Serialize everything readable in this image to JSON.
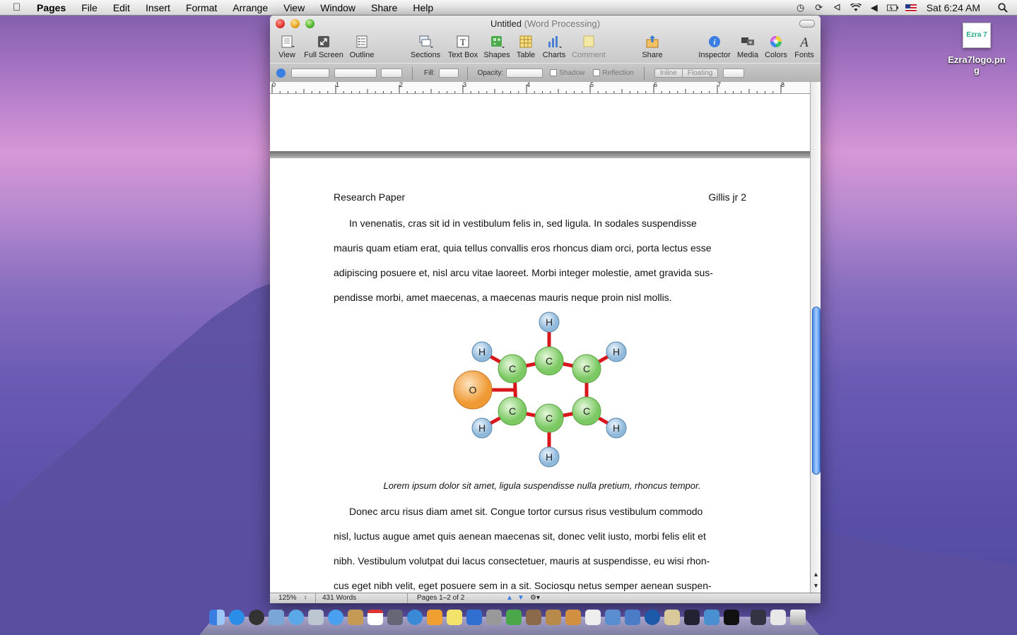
{
  "menubar": {
    "app_name": "Pages",
    "menus": [
      "File",
      "Edit",
      "Insert",
      "Format",
      "Arrange",
      "View",
      "Window",
      "Share",
      "Help"
    ],
    "clock": "Sat 6:24 AM"
  },
  "window": {
    "title": "Untitled",
    "title_suffix": "(Word Processing)"
  },
  "toolbar": {
    "view": "View",
    "full_screen": "Full Screen",
    "outline": "Outline",
    "sections": "Sections",
    "text_box": "Text Box",
    "shapes": "Shapes",
    "table": "Table",
    "charts": "Charts",
    "comment": "Comment",
    "share": "Share",
    "inspector": "Inspector",
    "media": "Media",
    "colors": "Colors",
    "fonts": "Fonts"
  },
  "format_bar": {
    "fill_label": "Fill:",
    "opacity_label": "Opacity:",
    "shadow_label": "Shadow",
    "reflection_label": "Reflection",
    "inline_label": "Inline",
    "floating_label": "Floating"
  },
  "ruler": {
    "marks": [
      "0",
      "1",
      "2",
      "3",
      "4",
      "5",
      "6",
      "7",
      "8"
    ]
  },
  "document": {
    "header_left": "Research Paper",
    "header_right": "Gillis jr 2",
    "para1_lines": [
      "In venenatis, cras sit id in vestibulum felis in, sed ligula. In sodales suspendisse",
      "mauris quam etiam erat, quia tellus convallis eros rhoncus diam orci, porta lectus esse",
      "adipiscing posuere et, nisl arcu vitae laoreet. Morbi integer molestie, amet gravida sus-",
      "pendisse morbi, amet maecenas, a maecenas mauris neque proin nisl mollis."
    ],
    "caption": "Lorem ipsum dolor sit amet, ligula suspendisse nulla pretium, rhoncus tempor.",
    "para2_lines": [
      "Donec arcu risus diam amet sit. Congue tortor cursus risus vestibulum commodo",
      "nisl, luctus augue amet quis aenean maecenas sit, donec velit iusto, morbi felis elit et",
      "nibh. Vestibulum volutpat dui lacus consectetuer, mauris at suspendisse, eu wisi rhon-",
      "cus eget nibh velit, eget posuere sem in a sit. Sociosqu netus semper aenean suspen-"
    ],
    "molecule_atoms": {
      "oxygen": "O",
      "carbon": "C",
      "hydrogen": "H"
    }
  },
  "statusbar": {
    "zoom": "125%",
    "words": "431 Words",
    "pages": "Pages 1–2 of 2"
  },
  "desktop_icon": {
    "thumb_text": "Ezra 7",
    "name": "Ezra7logo.png"
  },
  "colors": {
    "oxygen": "#f5a54a",
    "carbon": "#8ed37a",
    "hydrogen": "#a9cbe6",
    "bond": "#d8161c",
    "scroll_thumb": "#4a8be8"
  }
}
